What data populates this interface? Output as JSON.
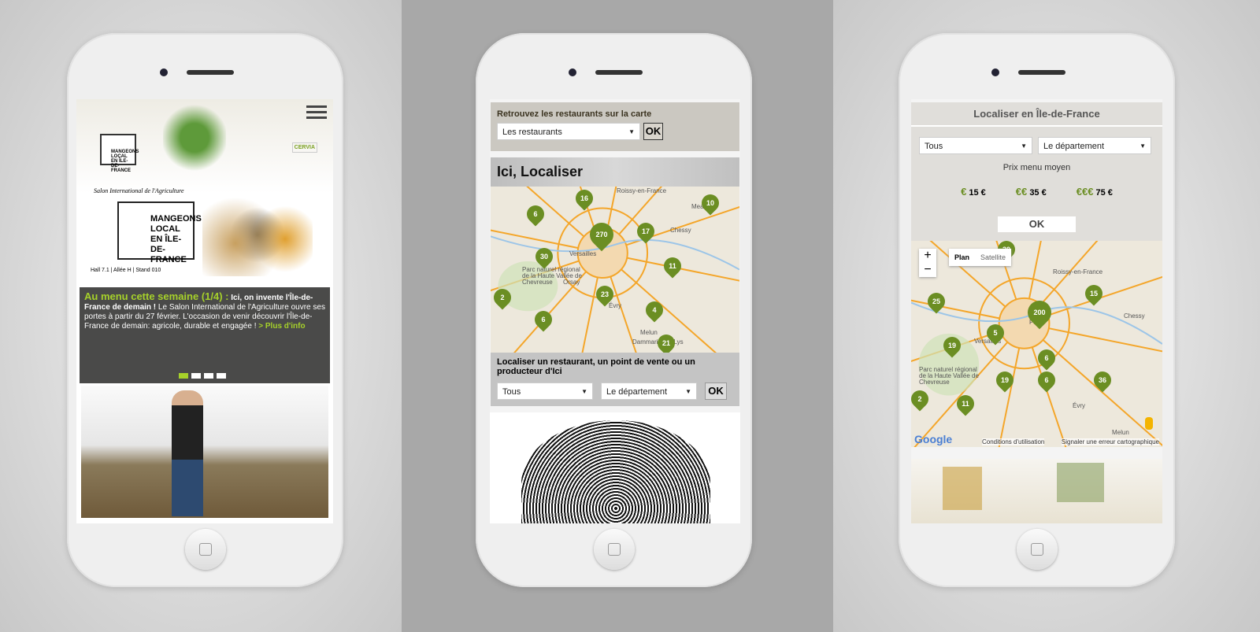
{
  "phone1": {
    "logo": "MANGEONS LOCAL EN ÎLE-DE-FRANCE",
    "partner": "CERVIA",
    "salon": "Salon International de l'Agriculture",
    "stand": "Hall 7.1 | Allée H | Stand 010",
    "headline": "Au menu cette semaine (1/4) :",
    "lead": "Ici, on invente l'Île-de-France de demain !",
    "body": "Le Salon International de l'Agriculture ouvre ses portes à partir du 27 février. L'occasion de venir découvrir l'Île-de-France de demain: agricole, durable et engagée !",
    "more": "> Plus d'info",
    "slides": 4,
    "active_slide": 1,
    "accent": "#a6d12a"
  },
  "phone2": {
    "restaurants_title": "Retrouvez les restaurants sur la carte",
    "restaurants_select": "Les restaurants",
    "ok": "OK",
    "section_title": "Ici, Localiser",
    "markers": [
      "16",
      "6",
      "270",
      "17",
      "10",
      "30",
      "11",
      "2",
      "23",
      "4",
      "6",
      "21"
    ],
    "places": [
      "Roissy-en-France",
      "Versailles",
      "Orsay",
      "Évry",
      "Melun",
      "Dammarie-lès-Lys",
      "Chessy",
      "Meaux",
      "Parc naturel régional de la Haute Vallée de Chevreuse"
    ],
    "locate_title": "Localiser un restaurant, un point de vente ou un producteur d'Ici",
    "type_select": "Tous",
    "dept_select": "Le département"
  },
  "phone3": {
    "title": "Localiser en Île-de-France",
    "type_select": "Tous",
    "dept_select": "Le département",
    "price_label": "Prix menu moyen",
    "prices": [
      {
        "sym": "€",
        "val": "15 €"
      },
      {
        "sym": "€€",
        "val": "35 €"
      },
      {
        "sym": "€€€",
        "val": "75 €"
      }
    ],
    "ok": "OK",
    "map_type": [
      "Plan",
      "Satellite"
    ],
    "zoom": [
      "+",
      "−"
    ],
    "markers": [
      "30",
      "25",
      "200",
      "15",
      "5",
      "6",
      "19",
      "19",
      "6",
      "36",
      "2",
      "11"
    ],
    "places": [
      "Roissy-en-France",
      "Paris",
      "Versailles",
      "Chessy",
      "Évry",
      "Melun",
      "Parc naturel régional de la Haute Vallée de Chevreuse"
    ],
    "google": "Google",
    "terms": "Conditions d'utilisation",
    "report": "Signaler une erreur cartographique",
    "price_color": "#6b8e23"
  }
}
